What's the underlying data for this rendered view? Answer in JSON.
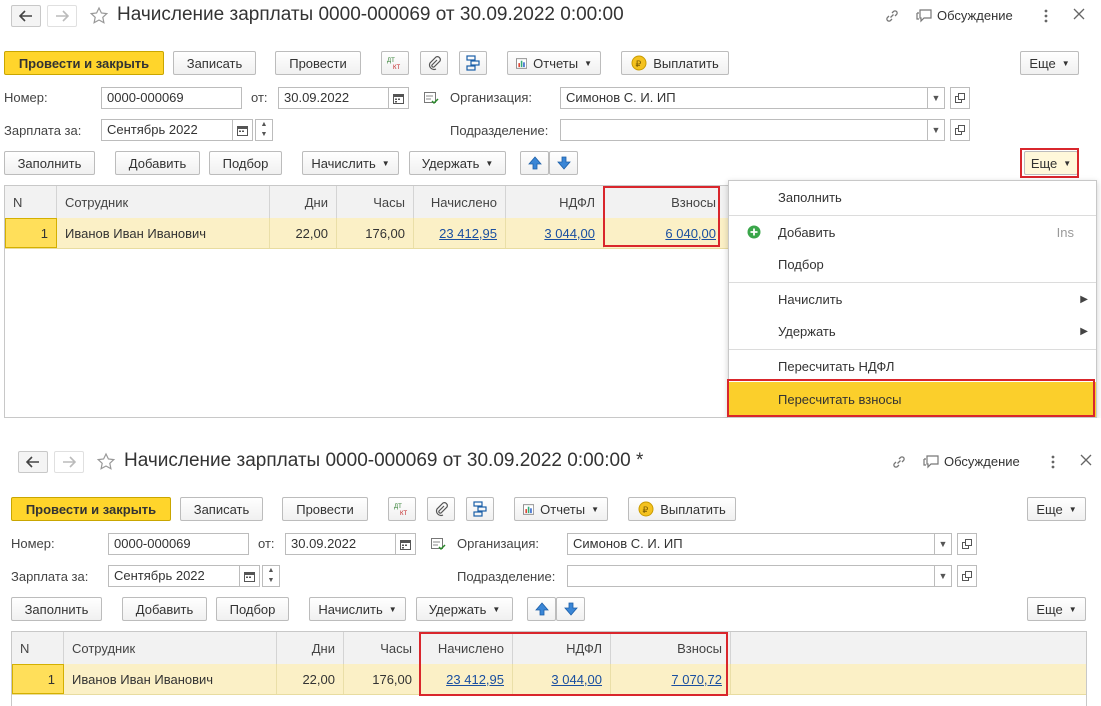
{
  "top": {
    "title": "Начисление зарплаты 0000-000069 от 30.09.2022 0:00:00",
    "discussion": "Обсуждение",
    "toolbar": {
      "post_close": "Провести и закрыть",
      "save": "Записать",
      "post": "Провести",
      "dtkt": "Дт Кт",
      "reports": "Отчеты",
      "pay": "Выплатить",
      "more": "Еще"
    },
    "form": {
      "number_label": "Номер:",
      "number_value": "0000-000069",
      "date_label": "от:",
      "date_value": "30.09.2022",
      "org_label": "Организация:",
      "org_value": "Симонов С. И. ИП",
      "salary_label": "Зарплата за:",
      "salary_value": "Сентябрь 2022",
      "dept_label": "Подразделение:",
      "dept_value": ""
    },
    "table_toolbar": {
      "fill": "Заполнить",
      "add": "Добавить",
      "select": "Подбор",
      "accrue": "Начислить",
      "withhold": "Удержать",
      "more": "Еще"
    },
    "columns": [
      "N",
      "Сотрудник",
      "Дни",
      "Часы",
      "Начислено",
      "НДФЛ",
      "Взносы"
    ],
    "row": {
      "n": "1",
      "employee": "Иванов Иван Иванович",
      "days": "22,00",
      "hours": "176,00",
      "accrued": "23 412,95",
      "ndfl": "3 044,00",
      "contrib": "6 040,00"
    },
    "menu": {
      "fill": "Заполнить",
      "add": "Добавить",
      "add_shortcut": "Ins",
      "select": "Подбор",
      "accrue": "Начислить",
      "withhold": "Удержать",
      "recalc_ndfl": "Пересчитать НДФЛ",
      "recalc_contrib": "Пересчитать взносы"
    }
  },
  "bottom": {
    "title": "Начисление зарплаты 0000-000069 от 30.09.2022 0:00:00 *",
    "discussion": "Обсуждение",
    "toolbar": {
      "post_close": "Провести и закрыть",
      "save": "Записать",
      "post": "Провести",
      "dtkt": "Дт Кт",
      "reports": "Отчеты",
      "pay": "Выплатить",
      "more": "Еще"
    },
    "form": {
      "number_label": "Номер:",
      "number_value": "0000-000069",
      "date_label": "от:",
      "date_value": "30.09.2022",
      "org_label": "Организация:",
      "org_value": "Симонов С. И. ИП",
      "salary_label": "Зарплата за:",
      "salary_value": "Сентябрь 2022",
      "dept_label": "Подразделение:",
      "dept_value": ""
    },
    "table_toolbar": {
      "fill": "Заполнить",
      "add": "Добавить",
      "select": "Подбор",
      "accrue": "Начислить",
      "withhold": "Удержать",
      "more": "Еще"
    },
    "columns": [
      "N",
      "Сотрудник",
      "Дни",
      "Часы",
      "Начислено",
      "НДФЛ",
      "Взносы"
    ],
    "row": {
      "n": "1",
      "employee": "Иванов Иван Иванович",
      "days": "22,00",
      "hours": "176,00",
      "accrued": "23 412,95",
      "ndfl": "3 044,00",
      "contrib": "7 070,72"
    }
  },
  "colors": {
    "primary": "#ffd52b",
    "highlight": "#fbcf2b",
    "annotation": "#d9262c",
    "link": "#1a4fa0",
    "row": "#fbf0c6"
  }
}
